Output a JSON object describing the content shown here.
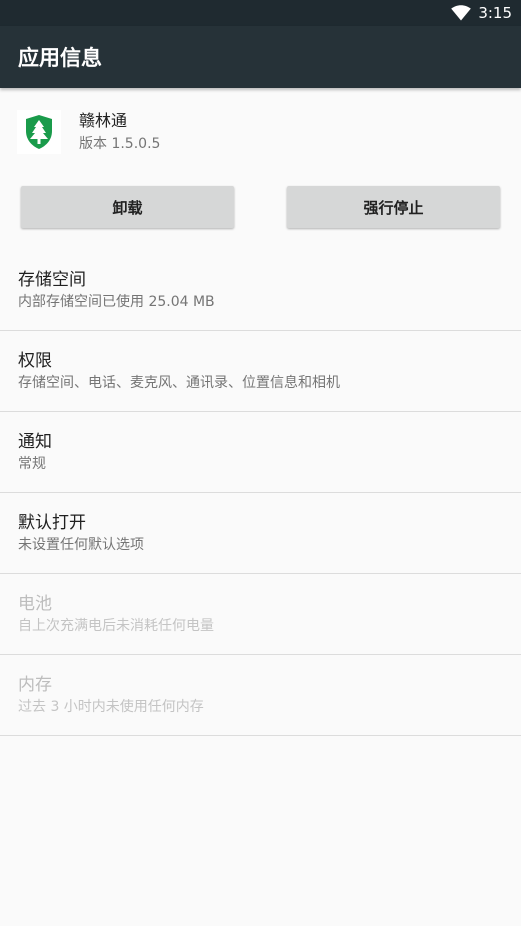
{
  "status_bar": {
    "time": "3:15",
    "wifi_icon": "wifi-icon"
  },
  "app_bar": {
    "title": "应用信息"
  },
  "app": {
    "name": "赣林通",
    "version": "版本 1.5.0.5",
    "icon": "pine-tree-shield-icon",
    "icon_color": "#1a9b4b"
  },
  "buttons": {
    "uninstall": "卸载",
    "force_stop": "强行停止"
  },
  "settings": [
    {
      "title": "存储空间",
      "subtitle": "内部存储空间已使用 25.04 MB",
      "enabled": true
    },
    {
      "title": "权限",
      "subtitle": "存储空间、电话、麦克风、通讯录、位置信息和相机",
      "enabled": true
    },
    {
      "title": "通知",
      "subtitle": "常规",
      "enabled": true
    },
    {
      "title": "默认打开",
      "subtitle": "未设置任何默认选项",
      "enabled": true
    },
    {
      "title": "电池",
      "subtitle": "自上次充满电后未消耗任何电量",
      "enabled": false
    },
    {
      "title": "内存",
      "subtitle": "过去 3 小时内未使用任何内存",
      "enabled": false
    }
  ],
  "colors": {
    "status_bar": "#1f2a30",
    "app_bar": "#263238",
    "background": "#fafafa",
    "button": "#d6d7d7"
  }
}
